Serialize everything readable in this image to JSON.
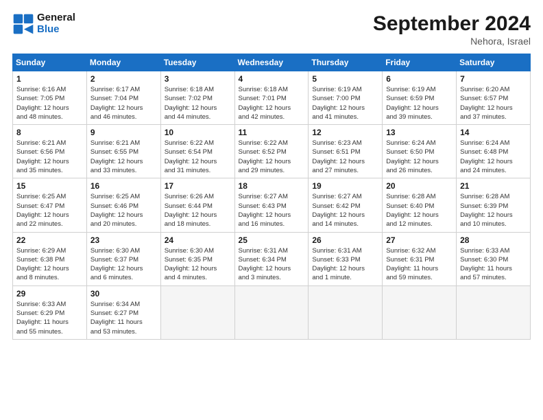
{
  "logo": {
    "general": "General",
    "blue": "Blue"
  },
  "title": "September 2024",
  "location": "Nehora, Israel",
  "days_header": [
    "Sunday",
    "Monday",
    "Tuesday",
    "Wednesday",
    "Thursday",
    "Friday",
    "Saturday"
  ],
  "weeks": [
    [
      {
        "day": "1",
        "info": "Sunrise: 6:16 AM\nSunset: 7:05 PM\nDaylight: 12 hours\nand 48 minutes."
      },
      {
        "day": "2",
        "info": "Sunrise: 6:17 AM\nSunset: 7:04 PM\nDaylight: 12 hours\nand 46 minutes."
      },
      {
        "day": "3",
        "info": "Sunrise: 6:18 AM\nSunset: 7:02 PM\nDaylight: 12 hours\nand 44 minutes."
      },
      {
        "day": "4",
        "info": "Sunrise: 6:18 AM\nSunset: 7:01 PM\nDaylight: 12 hours\nand 42 minutes."
      },
      {
        "day": "5",
        "info": "Sunrise: 6:19 AM\nSunset: 7:00 PM\nDaylight: 12 hours\nand 41 minutes."
      },
      {
        "day": "6",
        "info": "Sunrise: 6:19 AM\nSunset: 6:59 PM\nDaylight: 12 hours\nand 39 minutes."
      },
      {
        "day": "7",
        "info": "Sunrise: 6:20 AM\nSunset: 6:57 PM\nDaylight: 12 hours\nand 37 minutes."
      }
    ],
    [
      {
        "day": "8",
        "info": "Sunrise: 6:21 AM\nSunset: 6:56 PM\nDaylight: 12 hours\nand 35 minutes."
      },
      {
        "day": "9",
        "info": "Sunrise: 6:21 AM\nSunset: 6:55 PM\nDaylight: 12 hours\nand 33 minutes."
      },
      {
        "day": "10",
        "info": "Sunrise: 6:22 AM\nSunset: 6:54 PM\nDaylight: 12 hours\nand 31 minutes."
      },
      {
        "day": "11",
        "info": "Sunrise: 6:22 AM\nSunset: 6:52 PM\nDaylight: 12 hours\nand 29 minutes."
      },
      {
        "day": "12",
        "info": "Sunrise: 6:23 AM\nSunset: 6:51 PM\nDaylight: 12 hours\nand 27 minutes."
      },
      {
        "day": "13",
        "info": "Sunrise: 6:24 AM\nSunset: 6:50 PM\nDaylight: 12 hours\nand 26 minutes."
      },
      {
        "day": "14",
        "info": "Sunrise: 6:24 AM\nSunset: 6:48 PM\nDaylight: 12 hours\nand 24 minutes."
      }
    ],
    [
      {
        "day": "15",
        "info": "Sunrise: 6:25 AM\nSunset: 6:47 PM\nDaylight: 12 hours\nand 22 minutes."
      },
      {
        "day": "16",
        "info": "Sunrise: 6:25 AM\nSunset: 6:46 PM\nDaylight: 12 hours\nand 20 minutes."
      },
      {
        "day": "17",
        "info": "Sunrise: 6:26 AM\nSunset: 6:44 PM\nDaylight: 12 hours\nand 18 minutes."
      },
      {
        "day": "18",
        "info": "Sunrise: 6:27 AM\nSunset: 6:43 PM\nDaylight: 12 hours\nand 16 minutes."
      },
      {
        "day": "19",
        "info": "Sunrise: 6:27 AM\nSunset: 6:42 PM\nDaylight: 12 hours\nand 14 minutes."
      },
      {
        "day": "20",
        "info": "Sunrise: 6:28 AM\nSunset: 6:40 PM\nDaylight: 12 hours\nand 12 minutes."
      },
      {
        "day": "21",
        "info": "Sunrise: 6:28 AM\nSunset: 6:39 PM\nDaylight: 12 hours\nand 10 minutes."
      }
    ],
    [
      {
        "day": "22",
        "info": "Sunrise: 6:29 AM\nSunset: 6:38 PM\nDaylight: 12 hours\nand 8 minutes."
      },
      {
        "day": "23",
        "info": "Sunrise: 6:30 AM\nSunset: 6:37 PM\nDaylight: 12 hours\nand 6 minutes."
      },
      {
        "day": "24",
        "info": "Sunrise: 6:30 AM\nSunset: 6:35 PM\nDaylight: 12 hours\nand 4 minutes."
      },
      {
        "day": "25",
        "info": "Sunrise: 6:31 AM\nSunset: 6:34 PM\nDaylight: 12 hours\nand 3 minutes."
      },
      {
        "day": "26",
        "info": "Sunrise: 6:31 AM\nSunset: 6:33 PM\nDaylight: 12 hours\nand 1 minute."
      },
      {
        "day": "27",
        "info": "Sunrise: 6:32 AM\nSunset: 6:31 PM\nDaylight: 11 hours\nand 59 minutes."
      },
      {
        "day": "28",
        "info": "Sunrise: 6:33 AM\nSunset: 6:30 PM\nDaylight: 11 hours\nand 57 minutes."
      }
    ],
    [
      {
        "day": "29",
        "info": "Sunrise: 6:33 AM\nSunset: 6:29 PM\nDaylight: 11 hours\nand 55 minutes."
      },
      {
        "day": "30",
        "info": "Sunrise: 6:34 AM\nSunset: 6:27 PM\nDaylight: 11 hours\nand 53 minutes."
      },
      null,
      null,
      null,
      null,
      null
    ]
  ]
}
